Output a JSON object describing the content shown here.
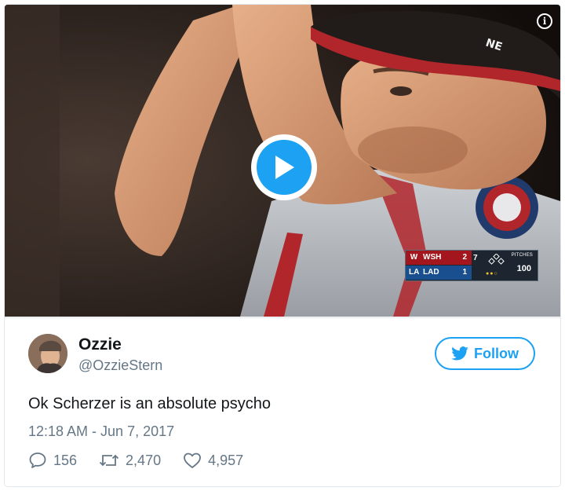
{
  "media": {
    "info_label": "i",
    "scorebug": {
      "home_team": "WSH",
      "home_score": "2",
      "away_team": "LAD",
      "away_score": "1",
      "inning": "7",
      "pitches_label": "PITCHES",
      "pitches": "100"
    }
  },
  "author": {
    "name": "Ozzie",
    "handle": "@OzzieStern"
  },
  "follow_label": "Follow",
  "tweet": {
    "text": "Ok Scherzer is an absolute psycho",
    "timestamp": "12:18 AM - Jun 7, 2017"
  },
  "stats": {
    "replies": "156",
    "retweets": "2,470",
    "likes": "4,957"
  },
  "colors": {
    "accent": "#1da1f2",
    "secondary_text": "#657786",
    "primary_text": "#14171a"
  }
}
